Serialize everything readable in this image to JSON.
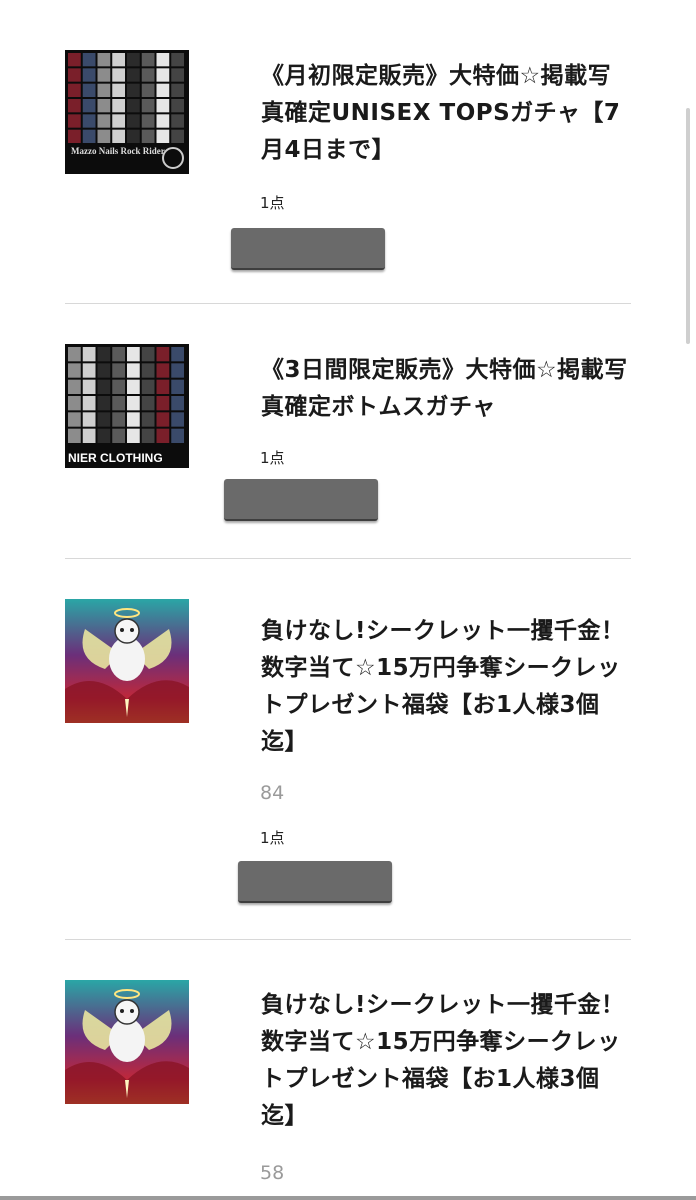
{
  "products": [
    {
      "thumbnail_icon": "tops-collage-thumbnail",
      "thumbnail_text": "Mazzo Nails  Rock Rider",
      "title": "《月初限定販売》大特価☆掲載写真確定UNISEX TOPSガチャ【7月4日まで】",
      "count": "1点"
    },
    {
      "thumbnail_icon": "bottoms-collage-thumbnail",
      "thumbnail_text": "NIER CLOTHING",
      "title": "《3日間限定販売》大特価☆掲載写真確定ボトムスガチャ",
      "count": "1点"
    },
    {
      "thumbnail_icon": "angel-character-thumbnail",
      "title": "負けなし!シークレット一攫千金！数字当て☆15万円争奪シークレットプレゼント福袋【お1人様3個迄】",
      "likes": "84",
      "count": "1点"
    },
    {
      "thumbnail_icon": "angel-character-thumbnail",
      "title": "負けなし!シークレット一攫千金！数字当て☆15万円争奪シークレットプレゼント福袋【お1人様3個迄】",
      "likes": "58"
    }
  ],
  "colors": {
    "redacted_bar": "#6a6a6a",
    "divider": "#d8d8d8",
    "muted_text": "#9a9a9a"
  }
}
